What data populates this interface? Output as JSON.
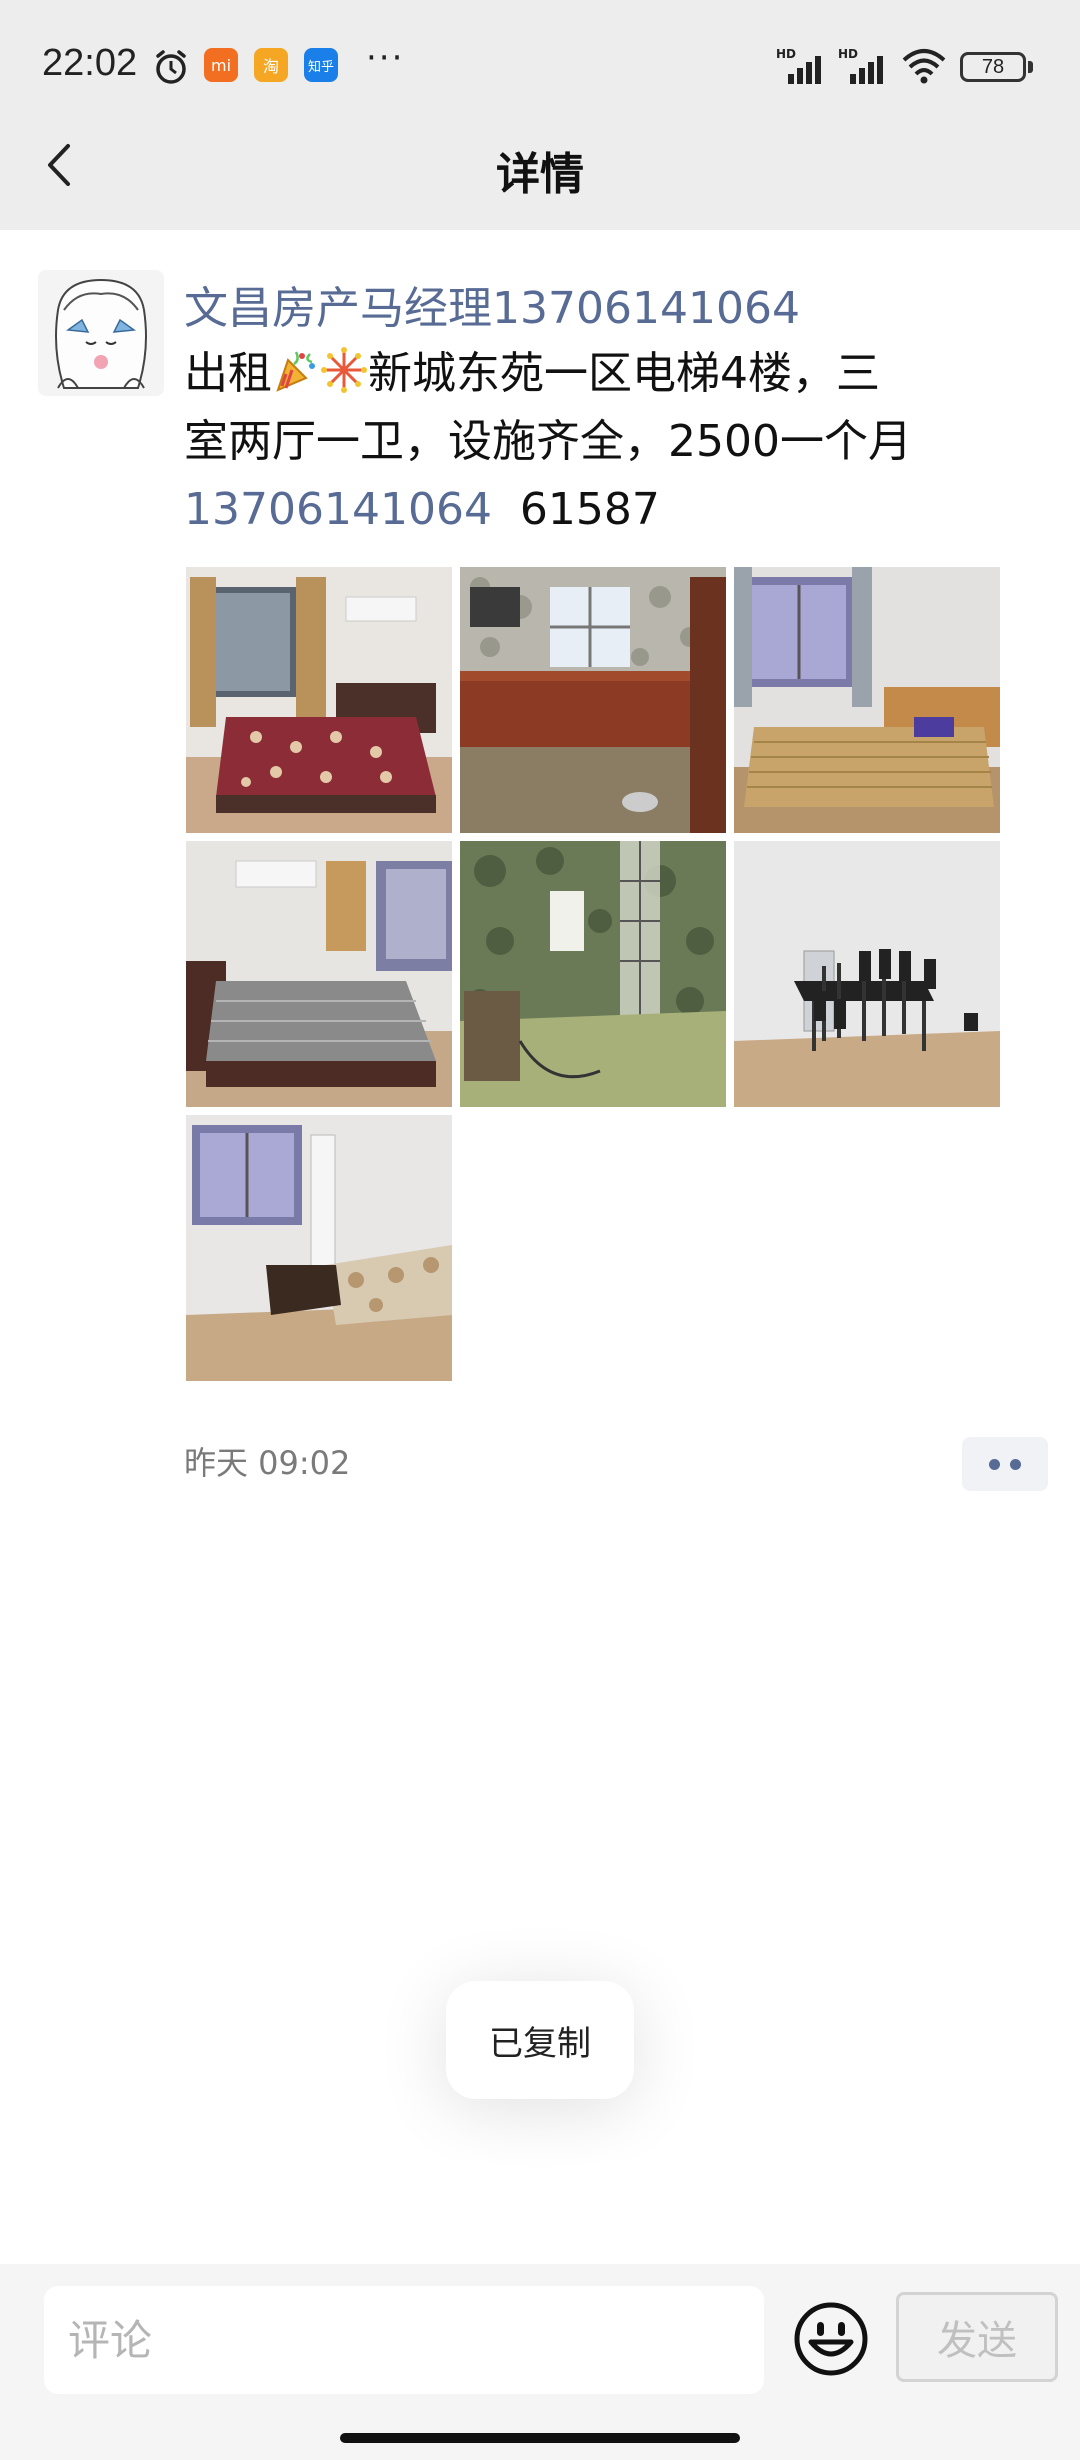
{
  "status_bar": {
    "time": "22:02",
    "app_badges": [
      {
        "label": "mi",
        "color": "#f26f21"
      },
      {
        "label": "淘",
        "color": "#f5a623"
      },
      {
        "label": "知乎",
        "color": "#1a7fe8"
      }
    ],
    "more": "···",
    "signal_label_1": "HD",
    "signal_label_2": "HD",
    "battery": "78"
  },
  "header": {
    "back_icon": "chevron-left-icon",
    "title": "详情"
  },
  "post": {
    "author": "文昌房产马经理13706141064",
    "text_line1_prefix": "出租",
    "emojis": [
      "party-popper-icon",
      "fireworks-icon"
    ],
    "text_line1_suffix": "新城东苑一区电梯4楼，三",
    "text_line2": "室两厅一卫，设施齐全，2500一个月",
    "phone": "13706141064",
    "code": "61587",
    "photos": [
      {
        "name": "bedroom-with-floral-bedspread"
      },
      {
        "name": "kitchen"
      },
      {
        "name": "bedroom-with-bare-bed"
      },
      {
        "name": "bedroom-grey-mattress"
      },
      {
        "name": "bathroom"
      },
      {
        "name": "dining-room"
      },
      {
        "name": "living-room"
      }
    ],
    "time": "昨天 09:02",
    "more_icon": "more-dots-icon"
  },
  "toast": {
    "text": "已复制"
  },
  "comment_bar": {
    "placeholder": "评论",
    "emoji_icon": "smiley-face-icon",
    "send_label": "发送"
  }
}
